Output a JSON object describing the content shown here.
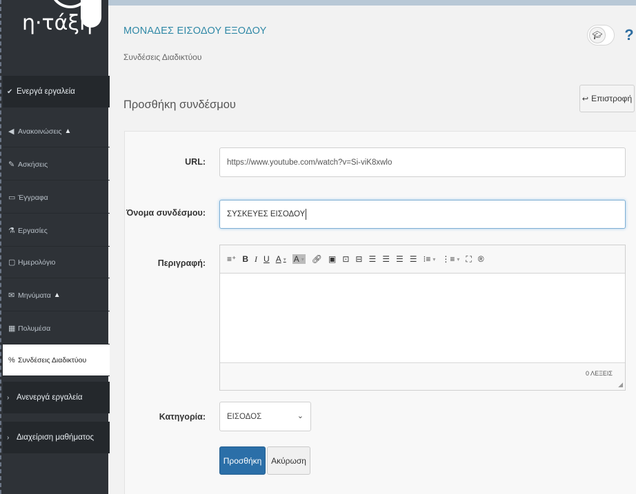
{
  "logo": {
    "text": "η·τάξη"
  },
  "sidebar": {
    "active_tools_label": "Ενεργά εργαλεία",
    "items": [
      {
        "label": "Ανακοινώσεις",
        "icon": "megaphone-icon",
        "warning": "▲"
      },
      {
        "label": "Ασκήσεις",
        "icon": "edit-icon",
        "warning": ""
      },
      {
        "label": "Έγγραφα",
        "icon": "folder-icon",
        "warning": ""
      },
      {
        "label": "Εργασίες",
        "icon": "flask-icon",
        "warning": ""
      },
      {
        "label": "Ημερολόγιο",
        "icon": "calendar-icon",
        "warning": ""
      },
      {
        "label": "Μηνύματα",
        "icon": "envelope-icon",
        "warning": "▲"
      },
      {
        "label": "Πολυμέσα",
        "icon": "film-icon",
        "warning": ""
      },
      {
        "label": "Συνδέσεις Διαδικτύου",
        "icon": "link-icon",
        "warning": ""
      }
    ],
    "inactive_tools_label": "Ανενεργά εργαλεία",
    "course_admin_label": "Διαχείριση μαθήματος"
  },
  "header": {
    "course_title": "ΜΟΝΑΔΕΣ ΕΙΣΟΔΟΥ ΕΞΟΔΟΥ",
    "subtitle": "Συνδέσεις Διαδικτύου",
    "help": "?"
  },
  "page": {
    "title": "Προσθήκη συνδέσμου",
    "back_label": "Επιστροφή"
  },
  "form": {
    "url_label": "URL:",
    "url_value": "https://www.youtube.com/watch?v=Si-viK8xwlo",
    "name_label": "Όνομα συνδέσμου:",
    "name_value": "ΣΥΣΚΕΥΕΣ ΕΙΣΟΔΟΥ",
    "description_label": "Περιγραφή:",
    "word_count": "0 ΛΕΞΕΙΣ",
    "category_label": "Κατηγορία:",
    "category_value": "ΕΙΣΟΔΟΣ",
    "submit_label": "Προσθήκη",
    "cancel_label": "Ακύρωση"
  },
  "toolbar": {
    "bold": "B",
    "italic": "I",
    "underline": "U",
    "font_color": "A",
    "bg_color": "A"
  },
  "colors": {
    "accent": "#2f88a6",
    "primary_button": "#2b6fa8",
    "sidebar_bg": "#2e3237"
  }
}
